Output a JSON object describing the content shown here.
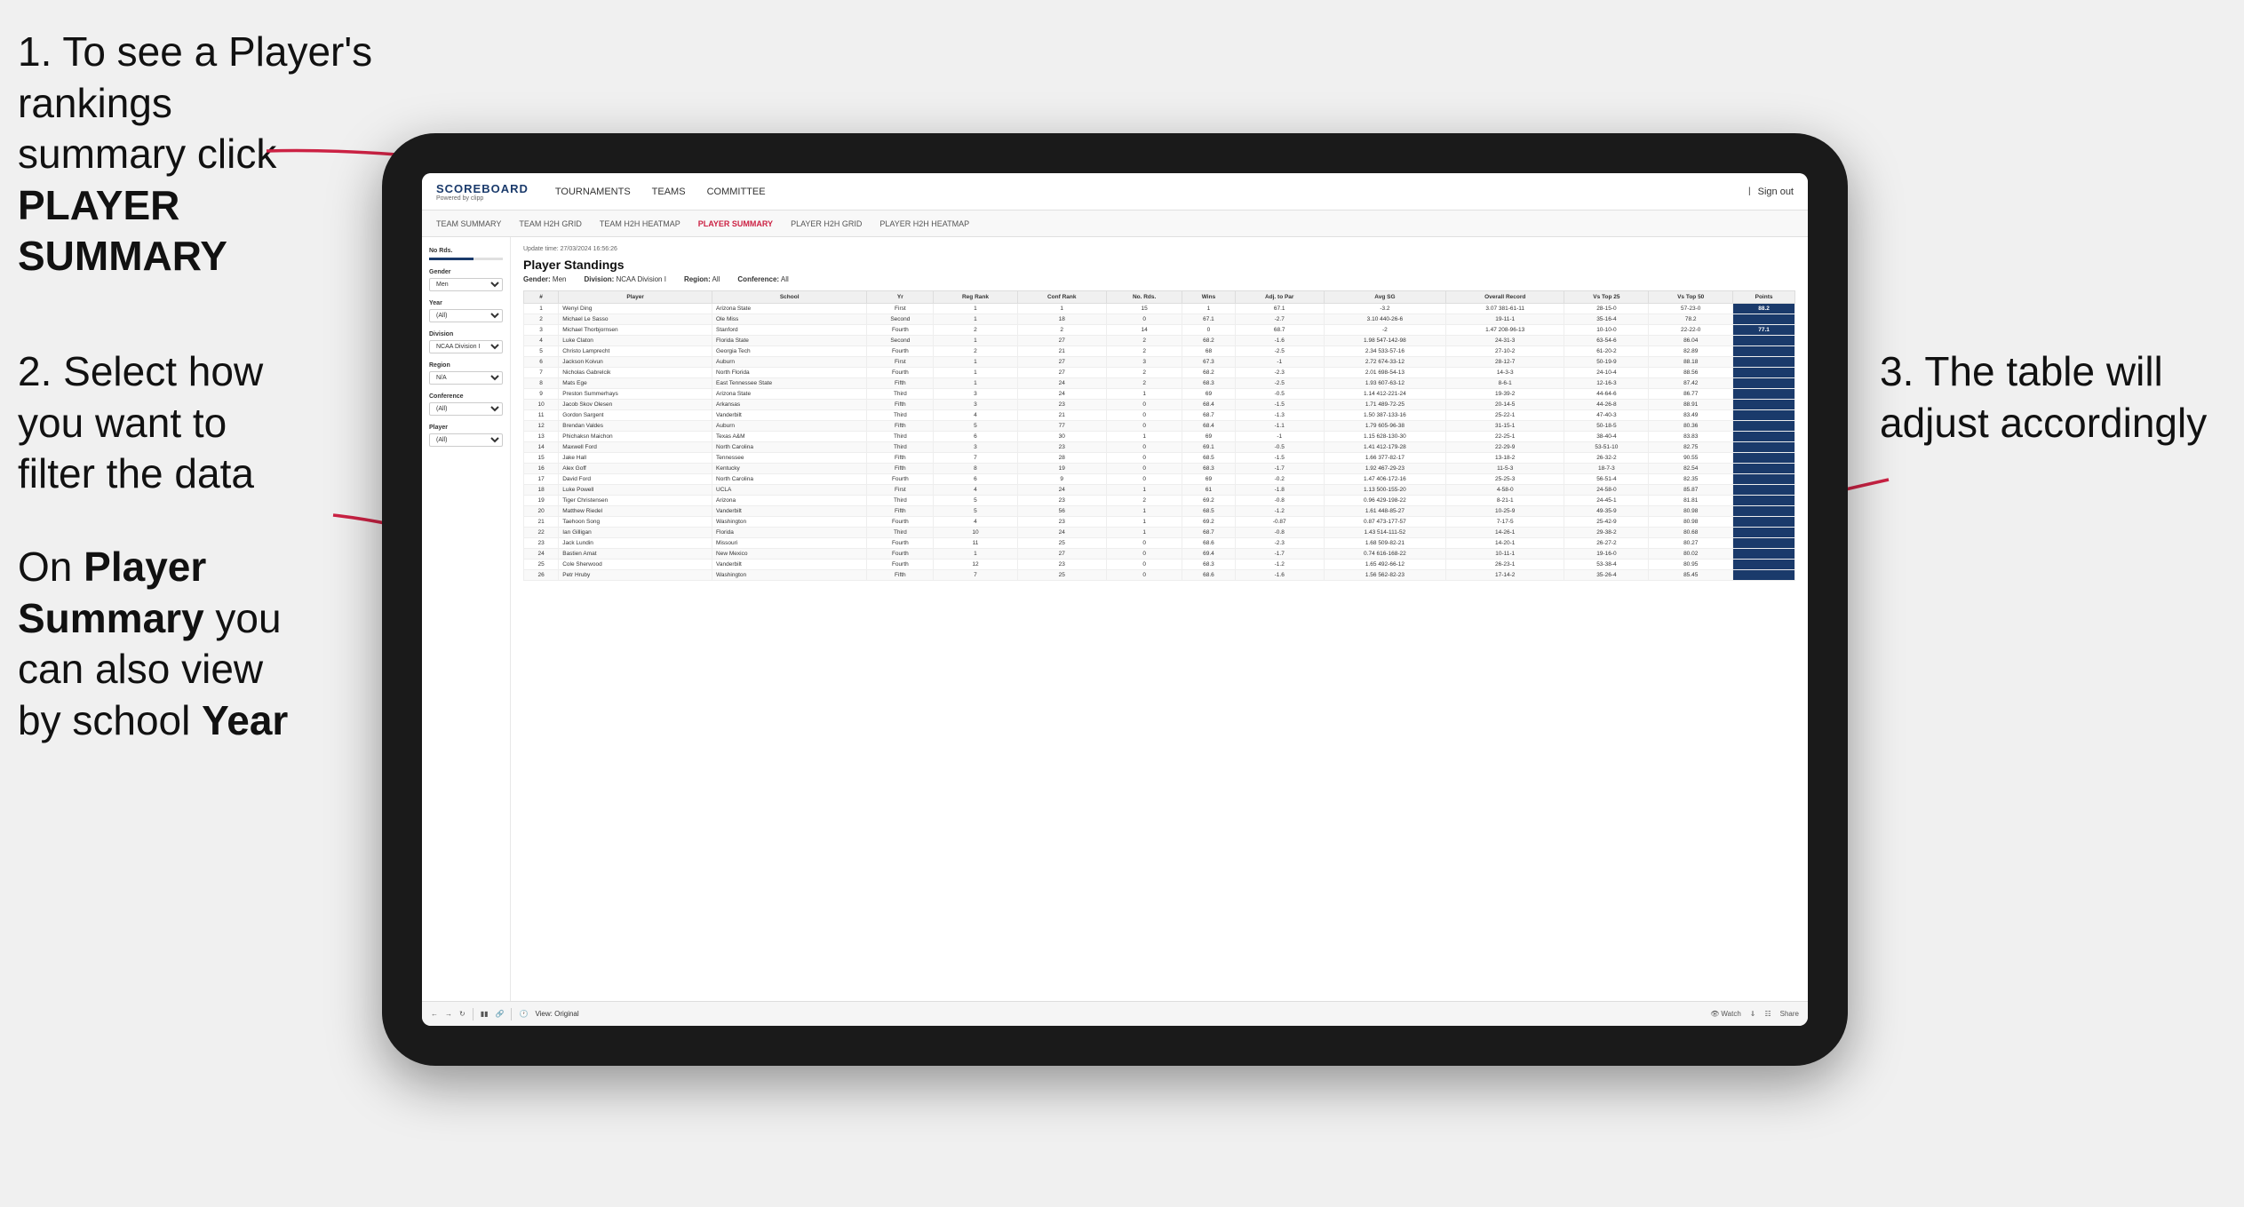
{
  "annotations": {
    "top_left_line1": "1. To see a Player's rankings",
    "top_left_line2": "summary click ",
    "top_left_bold": "PLAYER SUMMARY",
    "mid_left_line1": "2. Select how",
    "mid_left_line2": "you want to",
    "mid_left_line3": "filter the data",
    "bottom_left_line1": "On ",
    "bottom_left_bold1": "Player",
    "bottom_left_line2": "Summary",
    "bottom_left_normal": " you",
    "bottom_left_line3": "can also view",
    "bottom_left_line4": "by school ",
    "bottom_left_bold2": "Year",
    "right_line1": "3. The table will",
    "right_line2": "adjust accordingly"
  },
  "nav": {
    "logo_title": "SCOREBOARD",
    "logo_sub": "Powered by clipp",
    "items": [
      {
        "label": "TOURNAMENTS",
        "active": false
      },
      {
        "label": "TEAMS",
        "active": false
      },
      {
        "label": "COMMITTEE",
        "active": false
      }
    ],
    "sign_out": "Sign out"
  },
  "sub_nav": {
    "items": [
      {
        "label": "TEAM SUMMARY",
        "active": false
      },
      {
        "label": "TEAM H2H GRID",
        "active": false
      },
      {
        "label": "TEAM H2H HEATMAP",
        "active": false
      },
      {
        "label": "PLAYER SUMMARY",
        "active": true
      },
      {
        "label": "PLAYER H2H GRID",
        "active": false
      },
      {
        "label": "PLAYER H2H HEATMAP",
        "active": false
      }
    ]
  },
  "filters": {
    "no_rds_label": "No Rds.",
    "gender_label": "Gender",
    "gender_value": "Men",
    "year_label": "Year",
    "year_value": "(All)",
    "division_label": "Division",
    "division_value": "NCAA Division I",
    "region_label": "Region",
    "region_value": "N/A",
    "conference_label": "Conference",
    "conference_value": "(All)",
    "player_label": "Player",
    "player_value": "(All)"
  },
  "table": {
    "title": "Player Standings",
    "update_time": "Update time:",
    "update_date": "27/03/2024 16:56:26",
    "meta": {
      "gender_label": "Gender:",
      "gender_value": "Men",
      "division_label": "Division:",
      "division_value": "NCAA Division I",
      "region_label": "Region:",
      "region_value": "All",
      "conference_label": "Conference:",
      "conference_value": "All"
    },
    "columns": [
      "#",
      "Player",
      "School",
      "Yr",
      "Reg Rank",
      "Conf Rank",
      "No. Rds.",
      "Wins",
      "Adj. to Par",
      "Avg SG",
      "Overall Record",
      "Vs Top 25",
      "Vs Top 50",
      "Points"
    ],
    "rows": [
      [
        1,
        "Wenyi Ding",
        "Arizona State",
        "First",
        1,
        1,
        15,
        1,
        67.1,
        -3.2,
        "3.07 381-61-11",
        "28-15-0",
        "57-23-0",
        "88.2"
      ],
      [
        2,
        "Michael Le Sasso",
        "Ole Miss",
        "Second",
        1,
        18,
        0,
        67.1,
        -2.7,
        "3.10 440-26-6",
        "19-11-1",
        "35-16-4",
        "78.2"
      ],
      [
        3,
        "Michael Thorbjornsen",
        "Stanford",
        "Fourth",
        2,
        2,
        14,
        0,
        68.7,
        -2.0,
        "1.47 208-96-13",
        "10-10-0",
        "22-22-0",
        "77.1"
      ],
      [
        4,
        "Luke Claton",
        "Florida State",
        "Second",
        1,
        27,
        2,
        68.2,
        -1.6,
        "1.98 547-142-98",
        "24-31-3",
        "63-54-6",
        "86.04"
      ],
      [
        5,
        "Christo Lamprecht",
        "Georgia Tech",
        "Fourth",
        2,
        21,
        2,
        68.0,
        -2.5,
        "2.34 533-57-16",
        "27-10-2",
        "61-20-2",
        "82.89"
      ],
      [
        6,
        "Jackson Koivun",
        "Auburn",
        "First",
        1,
        27,
        3,
        67.3,
        -1.0,
        "2.72 674-33-12",
        "28-12-7",
        "50-19-9",
        "88.18"
      ],
      [
        7,
        "Nicholas Gabrelcik",
        "North Florida",
        "Fourth",
        1,
        27,
        2,
        68.2,
        -2.3,
        "2.01 698-54-13",
        "14-3-3",
        "24-10-4",
        "88.56"
      ],
      [
        8,
        "Mats Ege",
        "East Tennessee State",
        "Fifth",
        1,
        24,
        2,
        68.3,
        -2.5,
        "1.93 607-63-12",
        "8-6-1",
        "12-16-3",
        "87.42"
      ],
      [
        9,
        "Preston Summerhays",
        "Arizona State",
        "Third",
        3,
        24,
        1,
        69.0,
        -0.5,
        "1.14 412-221-24",
        "19-39-2",
        "44-64-6",
        "86.77"
      ],
      [
        10,
        "Jacob Skov Olesen",
        "Arkansas",
        "Fifth",
        3,
        23,
        0,
        68.4,
        -1.5,
        "1.71 489-72-25",
        "20-14-5",
        "44-26-8",
        "88.91"
      ],
      [
        11,
        "Gordon Sargent",
        "Vanderbilt",
        "Third",
        4,
        21,
        0,
        68.7,
        -1.3,
        "1.50 387-133-16",
        "25-22-1",
        "47-40-3",
        "83.49"
      ],
      [
        12,
        "Brendan Valdes",
        "Auburn",
        "Fifth",
        5,
        77,
        0,
        68.4,
        -1.1,
        "1.79 605-96-38",
        "31-15-1",
        "50-18-5",
        "80.36"
      ],
      [
        13,
        "Phichaksn Maichon",
        "Texas A&M",
        "Third",
        6,
        30,
        1,
        69.0,
        -1.0,
        "1.15 628-130-30",
        "22-25-1",
        "38-40-4",
        "83.83"
      ],
      [
        14,
        "Maxwell Ford",
        "North Carolina",
        "Third",
        3,
        23,
        0,
        69.1,
        -0.5,
        "1.41 412-179-28",
        "22-29-9",
        "53-51-10",
        "82.75"
      ],
      [
        15,
        "Jake Hall",
        "Tennessee",
        "Fifth",
        7,
        28,
        0,
        68.5,
        -1.5,
        "1.66 377-82-17",
        "13-18-2",
        "26-32-2",
        "90.55"
      ],
      [
        16,
        "Alex Goff",
        "Kentucky",
        "Fifth",
        8,
        19,
        0,
        68.3,
        -1.7,
        "1.92 467-29-23",
        "11-5-3",
        "18-7-3",
        "82.54"
      ],
      [
        17,
        "David Ford",
        "North Carolina",
        "Fourth",
        6,
        9,
        0,
        69.0,
        -0.2,
        "1.47 406-172-16",
        "25-25-3",
        "56-51-4",
        "82.35"
      ],
      [
        18,
        "Luke Powell",
        "UCLA",
        "First",
        4,
        24,
        1,
        61.0,
        -1.8,
        "1.13 500-155-20",
        "4-58-0",
        "24-58-0",
        "85.87"
      ],
      [
        19,
        "Tiger Christensen",
        "Arizona",
        "Third",
        5,
        23,
        2,
        69.2,
        -0.8,
        "0.96 429-198-22",
        "8-21-1",
        "24-45-1",
        "81.81"
      ],
      [
        20,
        "Matthew Riedel",
        "Vanderbilt",
        "Fifth",
        5,
        56,
        1,
        68.5,
        -1.2,
        "1.61 448-85-27",
        "10-25-9",
        "49-35-9",
        "80.98"
      ],
      [
        21,
        "Taehoon Song",
        "Washington",
        "Fourth",
        4,
        23,
        1,
        69.2,
        -0.87,
        "0.87 473-177-57",
        "7-17-5",
        "25-42-9",
        "80.98"
      ],
      [
        22,
        "Ian Gilligan",
        "Florida",
        "Third",
        10,
        24,
        1,
        68.7,
        -0.8,
        "1.43 514-111-52",
        "14-26-1",
        "29-38-2",
        "80.68"
      ],
      [
        23,
        "Jack Lundin",
        "Missouri",
        "Fourth",
        11,
        25,
        0,
        68.6,
        -2.3,
        "1.68 509-82-21",
        "14-20-1",
        "26-27-2",
        "80.27"
      ],
      [
        24,
        "Bastien Amat",
        "New Mexico",
        "Fourth",
        1,
        27,
        0,
        69.4,
        -1.7,
        "0.74 616-168-22",
        "10-11-1",
        "19-16-0",
        "80.02"
      ],
      [
        25,
        "Cole Sherwood",
        "Vanderbilt",
        "Fourth",
        12,
        23,
        0,
        68.3,
        -1.2,
        "1.65 492-66-12",
        "26-23-1",
        "53-38-4",
        "80.95"
      ],
      [
        26,
        "Petr Hruby",
        "Washington",
        "Fifth",
        7,
        25,
        0,
        68.6,
        -1.6,
        "1.56 562-82-23",
        "17-14-2",
        "35-26-4",
        "85.45"
      ]
    ]
  },
  "toolbar": {
    "view_label": "View: Original",
    "watch_label": "Watch",
    "share_label": "Share"
  }
}
